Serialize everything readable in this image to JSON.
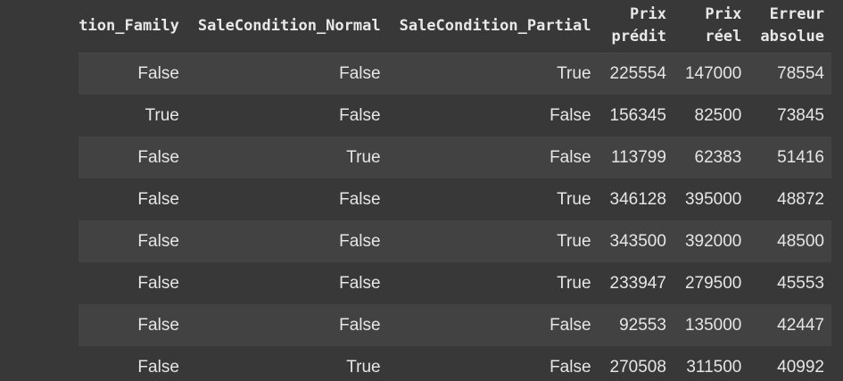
{
  "table": {
    "columns": [
      [
        "tion_Family"
      ],
      [
        "SaleCondition_Normal"
      ],
      [
        "SaleCondition_Partial"
      ],
      [
        "Prix",
        "prédit"
      ],
      [
        "Prix",
        "réel"
      ],
      [
        "Erreur",
        "absolue"
      ]
    ],
    "rows": [
      [
        "False",
        "False",
        "True",
        "225554",
        "147000",
        "78554"
      ],
      [
        "True",
        "False",
        "False",
        "156345",
        "82500",
        "73845"
      ],
      [
        "False",
        "True",
        "False",
        "113799",
        "62383",
        "51416"
      ],
      [
        "False",
        "False",
        "True",
        "346128",
        "395000",
        "48872"
      ],
      [
        "False",
        "False",
        "True",
        "343500",
        "392000",
        "48500"
      ],
      [
        "False",
        "False",
        "True",
        "233947",
        "279500",
        "45553"
      ],
      [
        "False",
        "False",
        "False",
        "92553",
        "135000",
        "42447"
      ],
      [
        "False",
        "True",
        "False",
        "270508",
        "311500",
        "40992"
      ]
    ]
  }
}
